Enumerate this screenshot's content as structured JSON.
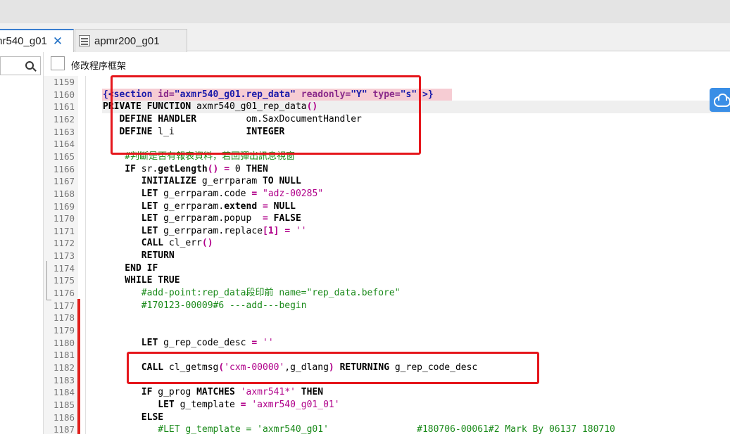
{
  "tabs": [
    {
      "label": "mr540_g01",
      "active": true
    },
    {
      "label": "apmr200_g01",
      "active": false
    }
  ],
  "options": {
    "modify_frame_label": "修改程序框架"
  },
  "accent_color": "#3b7fd0",
  "annotation_color": "#e5161c",
  "code_lines": [
    {
      "n": "1159",
      "tokens": []
    },
    {
      "n": "1160",
      "hl": "pink",
      "tokens": [
        {
          "t": "{<",
          "c": "sec"
        },
        {
          "t": "section",
          "c": "sec"
        },
        {
          "t": " id=",
          "c": "attr"
        },
        {
          "t": "\"axmr540_g01.rep_data\"",
          "c": "sec"
        },
        {
          "t": " readonly=",
          "c": "attr"
        },
        {
          "t": "\"Y\"",
          "c": "sec"
        },
        {
          "t": " type=",
          "c": "attr"
        },
        {
          "t": "\"s\"",
          "c": "sec"
        },
        {
          "t": " >}",
          "c": "sec"
        }
      ]
    },
    {
      "n": "1161",
      "hl": "gray",
      "tokens": [
        {
          "t": "PRIVATE FUNCTION",
          "c": "kw"
        },
        {
          "t": " axmr540_g01_rep_data"
        },
        {
          "t": "()",
          "c": "op"
        }
      ]
    },
    {
      "n": "1162",
      "tokens": [
        {
          "t": "   DEFINE HANDLER",
          "c": "kw"
        },
        {
          "t": "         om.SaxDocumentHandler"
        }
      ]
    },
    {
      "n": "1163",
      "tokens": [
        {
          "t": "   DEFINE",
          "c": "kw"
        },
        {
          "t": " l_i             "
        },
        {
          "t": "INTEGER",
          "c": "kw"
        }
      ]
    },
    {
      "n": "1164",
      "tokens": []
    },
    {
      "n": "1165",
      "tokens": [
        {
          "t": "    #判斷是否有報表資料，若回彈出訊息視窗",
          "c": "cmt"
        }
      ]
    },
    {
      "n": "1166",
      "tokens": [
        {
          "t": "    IF",
          "c": "kw"
        },
        {
          "t": " sr."
        },
        {
          "t": "getLength",
          "c": "kw"
        },
        {
          "t": "()",
          "c": "op"
        },
        {
          "t": " = ",
          "c": "op"
        },
        {
          "t": "0"
        },
        {
          "t": " THEN",
          "c": "kw"
        }
      ]
    },
    {
      "n": "1167",
      "tokens": [
        {
          "t": "       INITIALIZE",
          "c": "kw"
        },
        {
          "t": " g_errparam "
        },
        {
          "t": "TO NULL",
          "c": "kw"
        }
      ]
    },
    {
      "n": "1168",
      "tokens": [
        {
          "t": "       LET",
          "c": "kw"
        },
        {
          "t": " g_errparam.code "
        },
        {
          "t": "=",
          "c": "op"
        },
        {
          "t": " "
        },
        {
          "t": "\"adz-00285\"",
          "c": "str"
        }
      ]
    },
    {
      "n": "1169",
      "tokens": [
        {
          "t": "       LET",
          "c": "kw"
        },
        {
          "t": " g_errparam."
        },
        {
          "t": "extend",
          "c": "kw"
        },
        {
          "t": " "
        },
        {
          "t": "=",
          "c": "op"
        },
        {
          "t": " "
        },
        {
          "t": "NULL",
          "c": "kw"
        }
      ]
    },
    {
      "n": "1170",
      "tokens": [
        {
          "t": "       LET",
          "c": "kw"
        },
        {
          "t": " g_errparam.popup  "
        },
        {
          "t": "=",
          "c": "op"
        },
        {
          "t": " "
        },
        {
          "t": "FALSE",
          "c": "kw"
        }
      ]
    },
    {
      "n": "1171",
      "tokens": [
        {
          "t": "       LET",
          "c": "kw"
        },
        {
          "t": " g_errparam.replace"
        },
        {
          "t": "[1]",
          "c": "op"
        },
        {
          "t": " "
        },
        {
          "t": "=",
          "c": "op"
        },
        {
          "t": " "
        },
        {
          "t": "''",
          "c": "str"
        }
      ]
    },
    {
      "n": "1172",
      "tokens": [
        {
          "t": "       CALL",
          "c": "kw"
        },
        {
          "t": " cl_err"
        },
        {
          "t": "()",
          "c": "op"
        }
      ]
    },
    {
      "n": "1173",
      "tokens": [
        {
          "t": "       RETURN",
          "c": "kw"
        }
      ]
    },
    {
      "n": "1174",
      "tokens": [
        {
          "t": "    END IF",
          "c": "kw"
        }
      ]
    },
    {
      "n": "1175",
      "tokens": [
        {
          "t": "    WHILE TRUE",
          "c": "kw"
        }
      ]
    },
    {
      "n": "1176",
      "tokens": [
        {
          "t": "       #add-point:rep_data段印前 name=\"rep_data.before\"",
          "c": "cmt"
        }
      ]
    },
    {
      "n": "1177",
      "tokens": [
        {
          "t": "       #170123-00009#6 ---add---begin",
          "c": "cmt"
        }
      ]
    },
    {
      "n": "1178",
      "tokens": []
    },
    {
      "n": "1179",
      "tokens": []
    },
    {
      "n": "1180",
      "tokens": [
        {
          "t": "       LET",
          "c": "kw"
        },
        {
          "t": " g_rep_code_desc "
        },
        {
          "t": "=",
          "c": "op"
        },
        {
          "t": " "
        },
        {
          "t": "''",
          "c": "str"
        }
      ]
    },
    {
      "n": "1181",
      "tokens": []
    },
    {
      "n": "1182",
      "tokens": [
        {
          "t": "       CALL",
          "c": "kw"
        },
        {
          "t": " cl_getmsg"
        },
        {
          "t": "(",
          "c": "op"
        },
        {
          "t": "'cxm-00000'",
          "c": "str"
        },
        {
          "t": ",g_dlang"
        },
        {
          "t": ")",
          "c": "op"
        },
        {
          "t": " RETURNING",
          "c": "kw"
        },
        {
          "t": " g_rep_code_desc"
        }
      ]
    },
    {
      "n": "1183",
      "tokens": []
    },
    {
      "n": "1184",
      "tokens": [
        {
          "t": "       IF",
          "c": "kw"
        },
        {
          "t": " g_prog "
        },
        {
          "t": "MATCHES",
          "c": "kw"
        },
        {
          "t": " "
        },
        {
          "t": "'axmr541*'",
          "c": "str"
        },
        {
          "t": " THEN",
          "c": "kw"
        }
      ]
    },
    {
      "n": "1185",
      "tokens": [
        {
          "t": "          LET",
          "c": "kw"
        },
        {
          "t": " g_template "
        },
        {
          "t": "=",
          "c": "op"
        },
        {
          "t": " "
        },
        {
          "t": "'axmr540_g01_01'",
          "c": "str"
        }
      ]
    },
    {
      "n": "1186",
      "tokens": [
        {
          "t": "       ELSE",
          "c": "kw"
        }
      ]
    },
    {
      "n": "1187",
      "tokens": [
        {
          "t": "          #LET g_template = 'axmr540_g01'                #180706-00061#2 Mark By 06137 180710",
          "c": "cmt"
        }
      ]
    }
  ]
}
